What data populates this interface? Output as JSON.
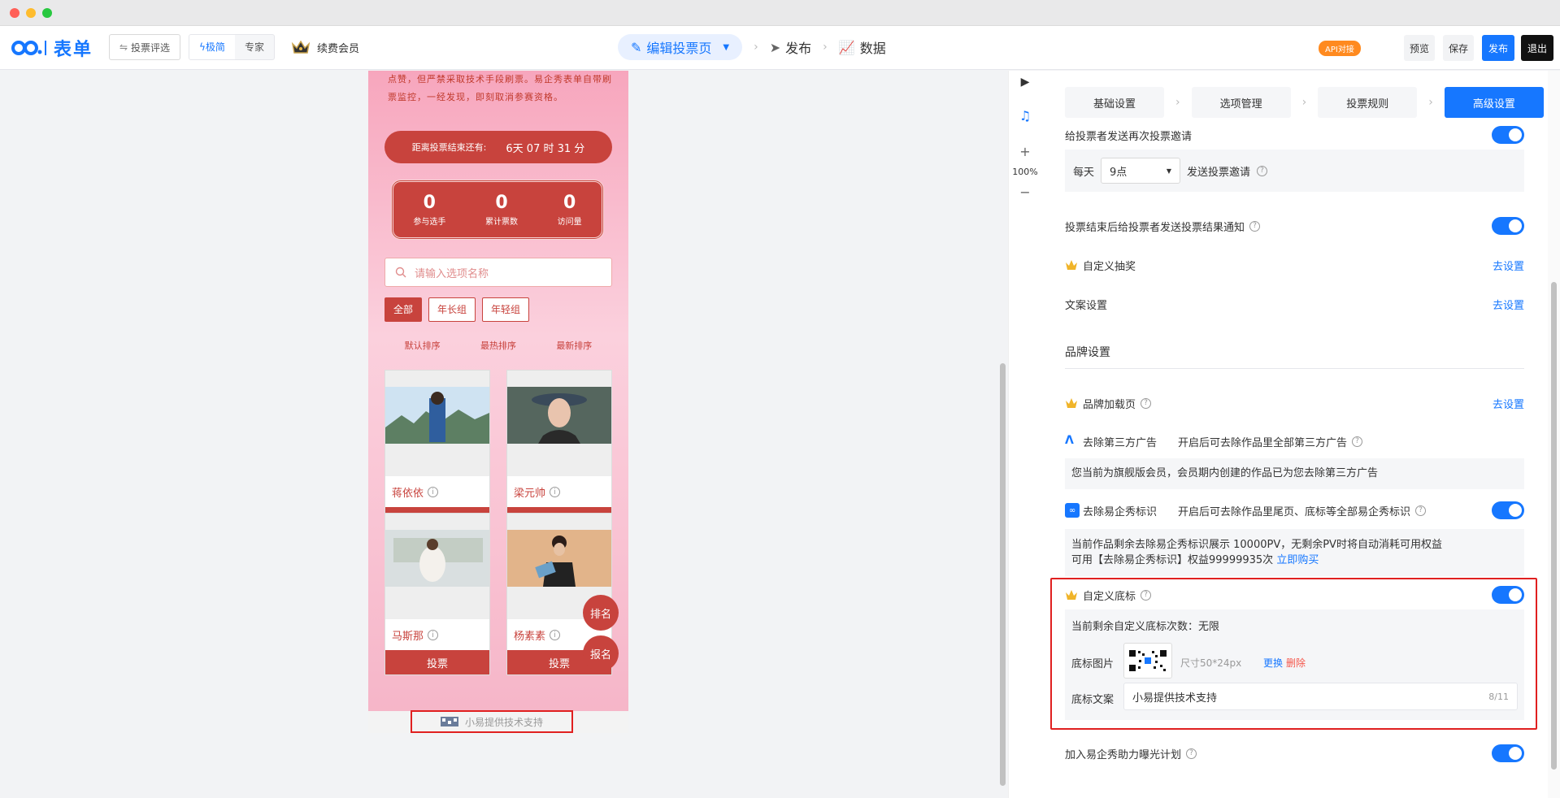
{
  "window": {
    "dots": [
      "#ff5f57",
      "#febc2e",
      "#28c840"
    ]
  },
  "header": {
    "brand": "表单",
    "vote_review": "投票评选",
    "mode_simple": "极简",
    "mode_expert": "专家",
    "member": "续费会员",
    "steps": [
      "编辑投票页",
      "发布",
      "数据"
    ],
    "api_badge": "API对接",
    "preview": "预览",
    "save": "保存",
    "publish": "发布",
    "exit": "退出"
  },
  "phone": {
    "rules_text": "点赞，但严禁采取技术手段刷票。易企秀表单自带刷票监控，一经发现，即刻取消参赛资格。",
    "countdown_label": "距离投票结束还有:",
    "countdown_value": "6天 07 时 31 分",
    "stats": [
      {
        "value": "0",
        "label": "参与选手"
      },
      {
        "value": "0",
        "label": "累计票数"
      },
      {
        "value": "0",
        "label": "访问量"
      }
    ],
    "search_placeholder": "请输入选项名称",
    "filters": [
      "全部",
      "年长组",
      "年轻组"
    ],
    "sorts": [
      "默认排序",
      "最热排序",
      "最新排序"
    ],
    "cards": [
      {
        "name": "蒋依依",
        "vote": "投票"
      },
      {
        "name": "梁元帅",
        "vote": "投票"
      },
      {
        "name": "马斯那",
        "vote": "投票"
      },
      {
        "name": "杨素素",
        "vote": "投票"
      }
    ],
    "fab_rank": "排名",
    "fab_signup": "报名",
    "footer_mark": "小易提供技术支持"
  },
  "toolrail": {
    "zoom": "100%",
    "plus": "+",
    "minus": "−"
  },
  "panel": {
    "tabs": [
      "基础设置",
      "选项管理",
      "投票规则",
      "高级设置"
    ],
    "resend_invite": "给投票者发送再次投票邀请",
    "daily_prefix": "每天",
    "daily_time": "9点",
    "daily_suffix": "发送投票邀请",
    "result_notice": "投票结束后给投票者发送投票结果通知",
    "custom_lottery": "自定义抽奖",
    "copy_settings": "文案设置",
    "go_set": "去设置",
    "brand_section": "品牌设置",
    "brand_loading": "品牌加载页",
    "remove_ads": "去除第三方广告",
    "remove_ads_desc": "开启后可去除作品里全部第三方广告",
    "remove_ads_note": "您当前为旗舰版会员，会员期内创建的作品已为您去除第三方广告",
    "remove_mark": "去除易企秀标识",
    "remove_mark_desc": "开启后可去除作品里尾页、底标等全部易企秀标识",
    "remove_mark_note1": "当前作品剩余去除易企秀标识展示 10000PV，无剩余PV时将自动消耗可用权益",
    "remove_mark_note2": "可用【去除易企秀标识】权益99999935次",
    "buy_now": "立即购买",
    "custom_footer": "自定义底标",
    "footer_remaining": "当前剩余自定义底标次数：无限",
    "footer_image_label": "底标图片",
    "footer_size": "尺寸50*24px",
    "replace": "更换",
    "delete": "删除",
    "footer_text_label": "底标文案",
    "footer_text_value": "小易提供技术支持",
    "footer_text_count": "8/11",
    "exposure_plan": "加入易企秀助力曝光计划"
  },
  "colors": {
    "accent": "#1677ff",
    "vote_red": "#c8433d",
    "highlight": "#e02020"
  }
}
